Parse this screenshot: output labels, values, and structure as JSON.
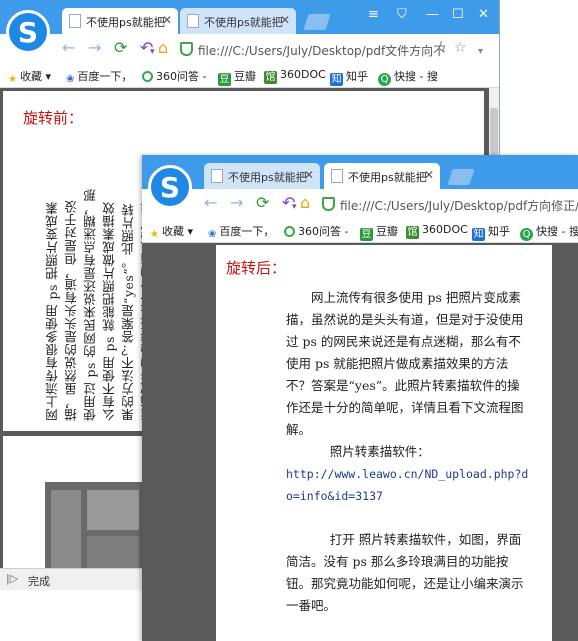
{
  "back_window": {
    "tabs": [
      {
        "title": "不使用ps就能把"
      },
      {
        "title": "不使用ps就能把"
      }
    ],
    "address": "file:///C:/Users/July/Desktop/pdf文件方向不",
    "bookmarks": [
      "收藏",
      "百度一下，",
      "360问答 -",
      "豆瓣",
      "360DOC",
      "知乎",
      "快搜 - 搜"
    ],
    "caption": "旋转前：",
    "rotated_columns": [
      "网上流传有很多使用 ps 把照片变成素",
      "描，虽然说的是头头有道，但是对于没",
      "使用过 ps 的网民来说还是有点迷糊，那",
      "么有不使用 ps 就能把照片做成素描效",
      "果的方法不？答案是“yes”。此照片转",
      "素描软件的操作还是十分的简单呢，详"
    ],
    "status": "完成"
  },
  "front_window": {
    "tabs": [
      {
        "title": "不使用ps就能把"
      },
      {
        "title": "不使用ps就能把"
      }
    ],
    "address": "file:///C:/Users/July/Desktop/pdf方向修正/不",
    "bookmarks": [
      "收藏",
      "百度一下，",
      "360问答 -",
      "豆瓣",
      "360DOC",
      "知乎",
      "快搜 - 搜"
    ],
    "caption": "旋转后：",
    "para1": "网上流传有很多使用 ps 把照片变成素描，虽然说的是头头有道，但是对于没使用过 ps 的网民来说还是有点迷糊，那么有不使用 ps 就能把照片做成素描效果的方法不？答案是“yes”。此照片转素描软件的操作还是十分的简单呢，详情且看下文流程图解。",
    "para2_label": "照片转素描软件：",
    "para2_link": "http://www.leawo.cn/ND_upload.php?do=info&id=3137",
    "para3": "打开 照片转素描软件，如图，界面简洁。没有 ps 那么多玲琅满目的功能按钮。那究竟功能如何呢，还是让小编来演示一番吧。"
  },
  "colors": {
    "titlebar": "#3d9be9",
    "caption": "#cc1111",
    "link": "#1f3c8c",
    "viewer_bg": "#5a5a5a"
  }
}
